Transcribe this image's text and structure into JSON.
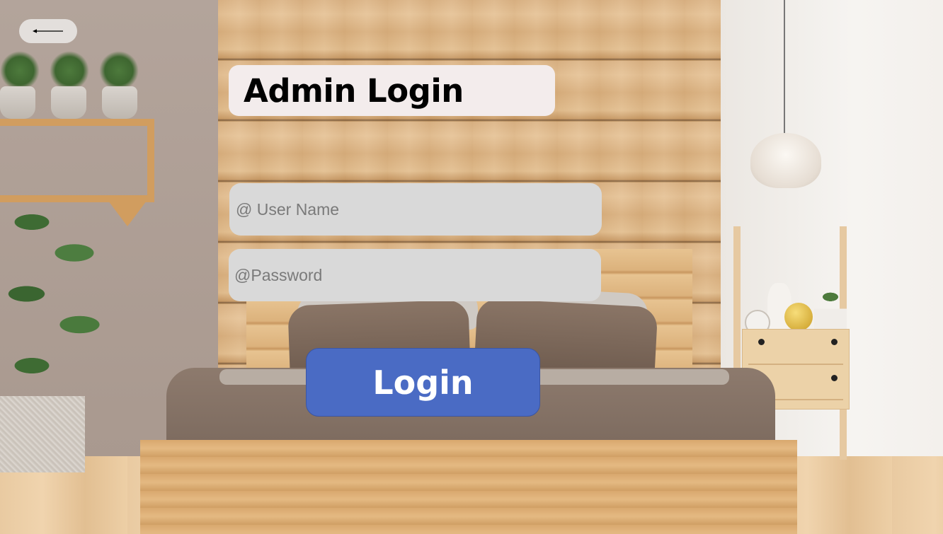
{
  "header": {
    "back_icon": "arrow-left-icon"
  },
  "login_form": {
    "title": "Admin Login",
    "username_placeholder": "@ User Name",
    "username_value": "",
    "password_placeholder": "@Password",
    "password_value": "",
    "submit_label": "Login"
  },
  "colors": {
    "login_button": "#4a6bc4",
    "input_background": "#d9d9d9",
    "title_card_background": "#f3ecec",
    "back_button_background": "#e3dfdc"
  }
}
